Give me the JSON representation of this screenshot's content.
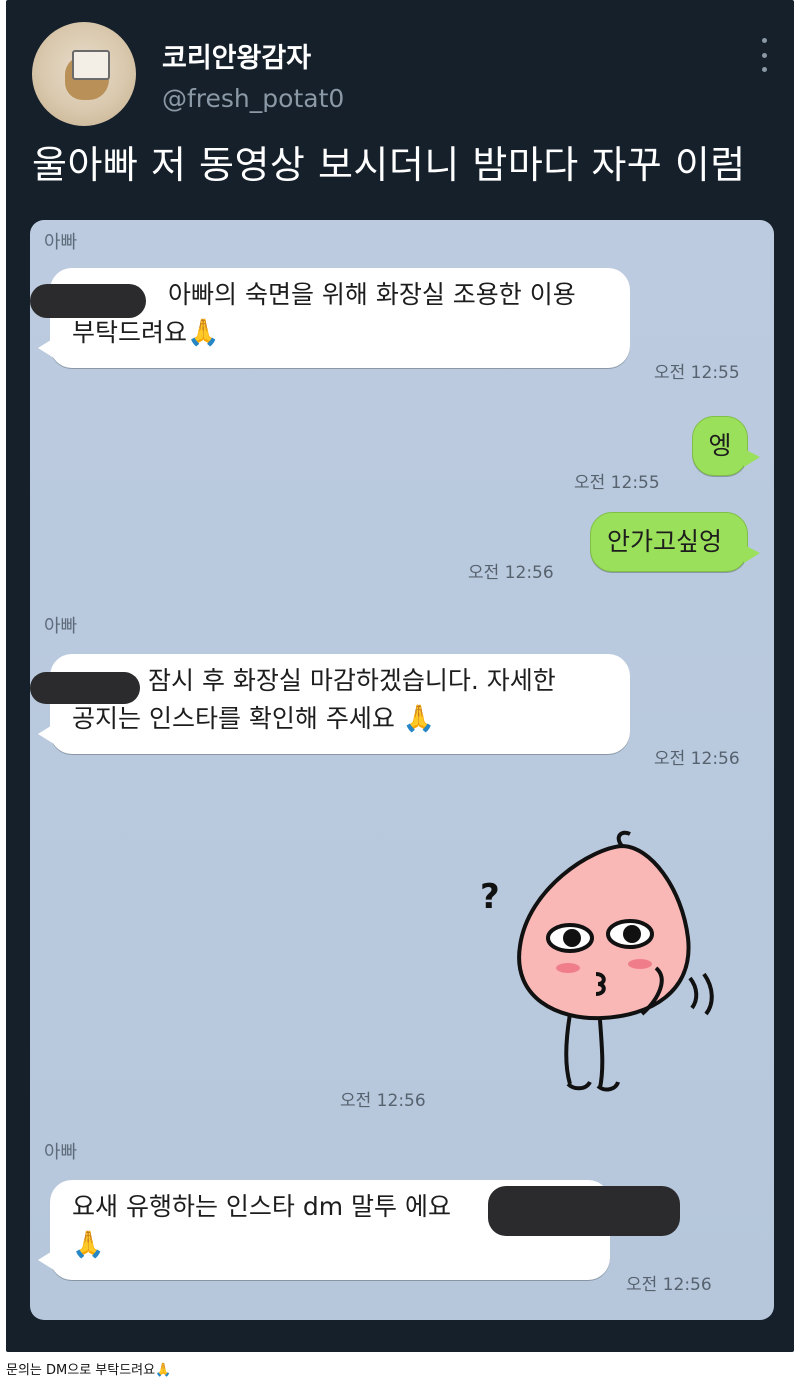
{
  "tweet": {
    "display_name": "코리안왕감자",
    "handle": "@fresh_potat0",
    "text": "울아빠 저 동영상 보시더니 밤마다 자꾸 이럼",
    "more_icon": "more-vertical-icon",
    "avatar_icon": "potato-avatar"
  },
  "chat": {
    "messages": [
      {
        "sender": "아빠",
        "line1": "아빠의 숙면을 위해 화장실 조용한 이용",
        "line2": "부탁드려요",
        "emoji": "🙏",
        "time": "오전 12:55"
      },
      {
        "text": "엥",
        "time": "오전 12:55"
      },
      {
        "text": "안가고싶엉",
        "time": "오전 12:56"
      },
      {
        "sender": "아빠",
        "line1": "잠시 후 화장실 마감하겠습니다. 자세한",
        "line2": "공지는 인스타를 확인해 주세요",
        "emoji": "🙏",
        "time": "오전 12:56"
      },
      {
        "sticker": "apeach-thinking-sticker",
        "question_mark": "?",
        "time": "오전 12:56"
      },
      {
        "sender": "아빠",
        "line1": "요새 유행하는 인스타 dm 말투 에요",
        "emoji": "🙏",
        "time": "오전 12:56"
      }
    ]
  },
  "caption": {
    "text": "문의는 DM으로 부탁드려요",
    "emoji": "🙏"
  },
  "colors": {
    "tweet_bg": "#15202b",
    "chat_bg": "#b8c9dd",
    "my_bubble": "#9be05a",
    "other_bubble": "#ffffff"
  }
}
